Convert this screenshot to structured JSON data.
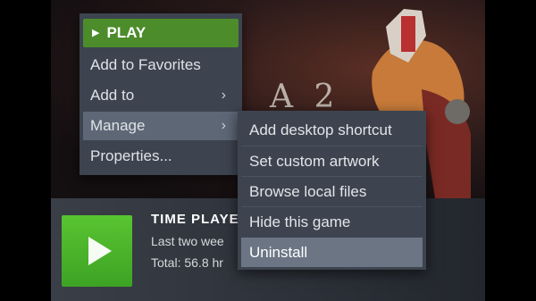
{
  "context_menu": {
    "play_label": "PLAY",
    "items": [
      {
        "label": "Add to Favorites"
      },
      {
        "label": "Add to",
        "arrow": "›"
      },
      {
        "label": "Manage",
        "arrow": "›"
      },
      {
        "label": "Properties..."
      }
    ]
  },
  "submenu": {
    "items": [
      {
        "label": "Add desktop shortcut"
      },
      {
        "label": "Set custom artwork"
      },
      {
        "label": "Browse local files"
      },
      {
        "label": "Hide this game"
      },
      {
        "label": "Uninstall"
      }
    ]
  },
  "game_panel": {
    "logo_text": "A 2",
    "time_title": "TIME PLAYE",
    "last_two_weeks": "Last two wee",
    "total": "Total: 56.8 hr"
  },
  "colors": {
    "play_green": "#4c8c2b",
    "tile_green": "#59c431",
    "menu_bg": "#3d4450",
    "highlight": "#6b7584"
  },
  "icons": {
    "play_triangle": "play-icon",
    "submenu_arrow": "chevron-right-icon"
  }
}
